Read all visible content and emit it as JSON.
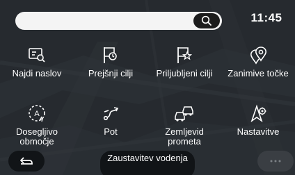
{
  "header": {
    "search": {
      "value": "",
      "icon": "search-icon"
    },
    "clock": "11:45"
  },
  "menu": {
    "items": [
      {
        "label": "Najdi naslov",
        "icon": "find-address-icon"
      },
      {
        "label": "Prejšnji cilji",
        "icon": "previous-destinations-icon"
      },
      {
        "label": "Priljubljeni cilji",
        "icon": "favourite-destinations-icon"
      },
      {
        "label": "Zanimive točke",
        "icon": "points-of-interest-icon"
      },
      {
        "label": "Dosegljivo območje",
        "icon": "reachable-area-icon"
      },
      {
        "label": "Pot",
        "icon": "route-icon"
      },
      {
        "label": "Zemljevid prometa",
        "icon": "traffic-map-icon"
      },
      {
        "label": "Nastavitve",
        "icon": "settings-icon"
      }
    ]
  },
  "footer": {
    "back_icon": "back-arrow-icon",
    "stop_label": "Zaustavitev vodenja",
    "more_icon": "more-dots-icon"
  },
  "colors": {
    "background": "#2c3035",
    "text": "#ffffff",
    "search_field": "#f4f4f4",
    "button": "#111417"
  }
}
